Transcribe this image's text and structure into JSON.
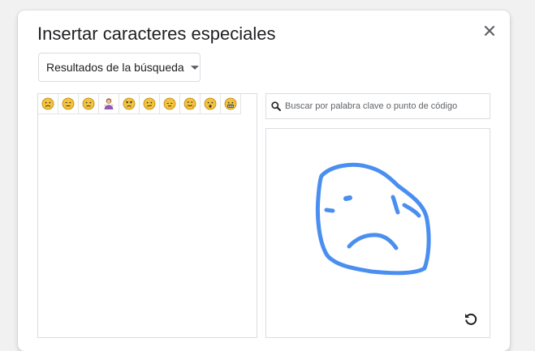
{
  "dialog": {
    "title": "Insertar caracteres especiales",
    "close_icon": "close-icon"
  },
  "category_dropdown": {
    "selected": "Resultados de la búsqueda"
  },
  "results": {
    "emojis": [
      {
        "name": "frowning-face"
      },
      {
        "name": "unamused-face"
      },
      {
        "name": "slightly-frowning-face"
      },
      {
        "name": "woman-shrugging"
      },
      {
        "name": "angry-face"
      },
      {
        "name": "confused-face"
      },
      {
        "name": "pensive-face"
      },
      {
        "name": "hugging-face"
      },
      {
        "name": "astonished-face"
      },
      {
        "name": "grimacing-face"
      }
    ]
  },
  "search": {
    "placeholder": "Buscar por palabra clave o punto de código",
    "value": ""
  },
  "drawing": {
    "stroke_color": "#4a8ff0",
    "reset_icon": "reset-icon"
  },
  "colors": {
    "face_yellow": "#f5c33b",
    "face_outline": "#b8860b",
    "person_purple": "#8e5ab5"
  }
}
